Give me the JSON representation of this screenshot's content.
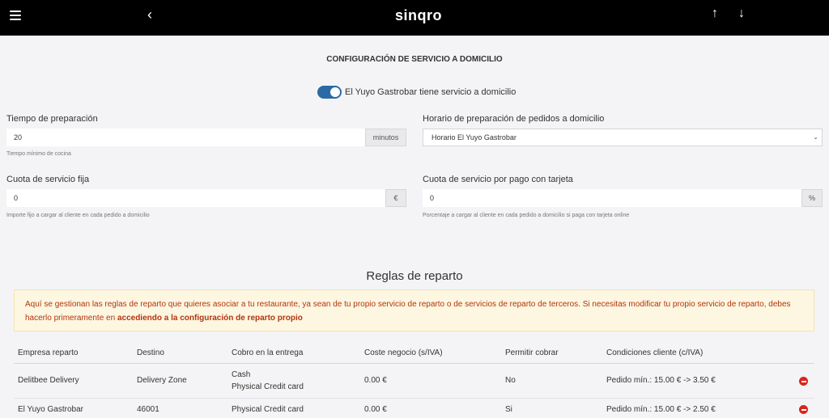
{
  "topbar": {
    "logo": "sinqro",
    "back_glyph": "‹",
    "up_glyph": "↑",
    "down_glyph": "↓",
    "icons": [
      "hamburger-icon",
      "chevron-left-icon",
      "arrow-up-icon",
      "arrow-down-icon"
    ]
  },
  "page": {
    "title": "CONFIGURACIÓN DE SERVICIO A DOMICILIO",
    "delivery_toggle_label": "El Yuyo Gastrobar tiene servicio a domicilio",
    "delivery_toggle_on": true
  },
  "form": {
    "prep_time": {
      "label": "Tiempo de preparación",
      "value": "20",
      "unit": "minutos",
      "help": "Tiempo mínimo de cocina"
    },
    "schedule": {
      "label": "Horario de preparación de pedidos a domicilio",
      "value": "Horario El Yuyo Gastrobar"
    },
    "fixed_fee": {
      "label": "Cuota de servicio fija",
      "value": "0",
      "unit": "€",
      "help": "Importe fijo a cargar al cliente en cada pedido a domicilio"
    },
    "card_fee": {
      "label": "Cuota de servicio por pago con tarjeta",
      "value": "0",
      "unit": "%",
      "help": "Porcentaje a cargar al cliente en cada pedido a domicilio si paga con tarjeta online"
    }
  },
  "rules": {
    "title": "Reglas de reparto",
    "alert_text": "Aquí se gestionan las reglas de reparto que quieres asociar a tu restaurante, ya sean de tu propio servicio de reparto o de servicios de reparto de terceros. Si necesitas modificar tu propio servicio de reparto, debes hacerlo primeramente en",
    "alert_link": "accediendo a la configuración de reparto propio",
    "columns": [
      "Empresa reparto",
      "Destino",
      "Cobro en la entrega",
      "Coste negocio (s/IVA)",
      "Permitir cobrar",
      "Condiciones cliente (c/IVA)"
    ],
    "rows": [
      {
        "company": "Delitbee Delivery",
        "destination": "Delivery Zone",
        "payment_1": "Cash",
        "payment_2": "Physical Credit card",
        "cost": "0.00 €",
        "allow": "No",
        "conditions": "Pedido mín.: 15.00 € -> 3.50 €"
      },
      {
        "company": "El Yuyo Gastrobar",
        "destination": "46001",
        "payment_1": "Physical Credit card",
        "payment_2": "",
        "cost": "0.00 €",
        "allow": "Si",
        "conditions": "Pedido mín.: 15.00 € -> 2.50 €"
      }
    ]
  }
}
